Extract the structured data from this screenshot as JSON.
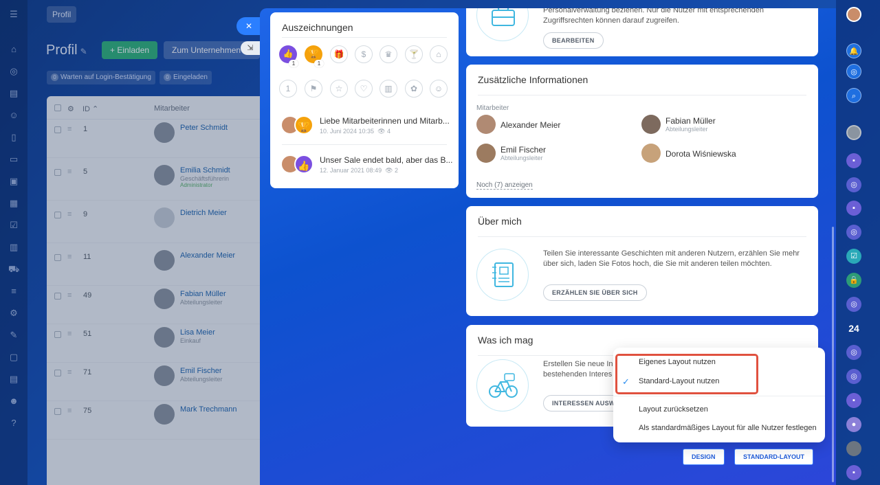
{
  "background_page": {
    "tab": "Profil",
    "title": "Profil",
    "invite_button": "+ Einladen",
    "company_button": "Zum Unternehmen h",
    "filters": [
      {
        "count": "0",
        "label": "Warten auf Login-Bestätigung"
      },
      {
        "count": "0",
        "label": "Eingeladen"
      }
    ],
    "table": {
      "col_id": "ID",
      "col_employee": "Mitarbeiter",
      "rows": [
        {
          "id": "1",
          "name": "Peter Schmidt",
          "position": "",
          "role": ""
        },
        {
          "id": "5",
          "name": "Emilia Schmidt",
          "position": "Geschäftsführerin",
          "role": "Administrator"
        },
        {
          "id": "9",
          "name": "Dietrich Meier",
          "position": "",
          "role": ""
        },
        {
          "id": "11",
          "name": "Alexander Meier",
          "position": "",
          "role": ""
        },
        {
          "id": "49",
          "name": "Fabian Müller",
          "position": "Abteilungsleiter",
          "role": ""
        },
        {
          "id": "51",
          "name": "Lisa Meier",
          "position": "Einkauf",
          "role": ""
        },
        {
          "id": "71",
          "name": "Emil Fischer",
          "position": "Abteilungsleiter",
          "role": ""
        },
        {
          "id": "75",
          "name": "Mark Trechmann",
          "position": "",
          "role": ""
        }
      ]
    }
  },
  "awards": {
    "title": "Auszeichnungen",
    "icons_row1": [
      "thumbs-up-icon",
      "trophy-icon",
      "gift-icon",
      "money-bag-icon",
      "crown-icon",
      "cocktail-icon",
      "cake-icon"
    ],
    "icons_row2": [
      "number-one-icon",
      "flag-icon",
      "star-icon",
      "heart-icon",
      "beer-icon",
      "flower-icon",
      "smile-icon"
    ],
    "badge_thumbs": "1",
    "badge_trophy": "1",
    "posts": [
      {
        "title": "Liebe Mitarbeiterinnen und Mitarb...",
        "date": "10. Juni 2024 10:35",
        "views": "4"
      },
      {
        "title": "Unser Sale endet bald, aber das B...",
        "date": "12. Januar 2021 08:49",
        "views": "2"
      }
    ]
  },
  "hr_card": {
    "text_line1": "Personalverwaltung beziehen. Nur die Nutzer mit entsprechenden",
    "text_line2": "Zugriffsrechten können darauf zugreifen.",
    "edit_button": "BEARBEITEN"
  },
  "additional_info": {
    "title": "Zusätzliche Informationen",
    "label": "Mitarbeiter",
    "employees": [
      {
        "name": "Alexander Meier",
        "position": ""
      },
      {
        "name": "Fabian Müller",
        "position": "Abteilungsleiter"
      },
      {
        "name": "Emil Fischer",
        "position": "Abteilungsleiter"
      },
      {
        "name": "Dorota Wiśniewska",
        "position": ""
      }
    ],
    "more_link": "Noch (7) anzeigen"
  },
  "about_me": {
    "title": "Über mich",
    "text_line1": "Teilen Sie interessante Geschichten mit anderen Nutzern, erzählen Sie mehr",
    "text_line2": "über sich, laden Sie Fotos hoch, die Sie mit anderen teilen möchten.",
    "button": "ERZÄHLEN SIE ÜBER SICH"
  },
  "interests": {
    "title": "Was ich mag",
    "text_line1": "Erstellen Sie neue In",
    "text_line2": "bestehenden Interes",
    "button": "INTERESSEN AUSW"
  },
  "layout_menu": {
    "items": [
      "Eigenes Layout nutzen",
      "Standard-Layout nutzen",
      "Layout zurücksetzen",
      "Als standardmäßiges Layout für alle Nutzer festlegen"
    ],
    "checked_index": 1
  },
  "bottom_buttons": {
    "design": "DESIGN",
    "standard_layout": "STANDARD-LAYOUT"
  },
  "right_bar": {
    "counter_badge": "24"
  },
  "colors": {
    "accent_blue": "#2b7fff",
    "highlight_red": "#e0513f",
    "award_purple": "#7b4fe0",
    "award_orange": "#f5a20c",
    "invite_green": "#2fb37b"
  }
}
